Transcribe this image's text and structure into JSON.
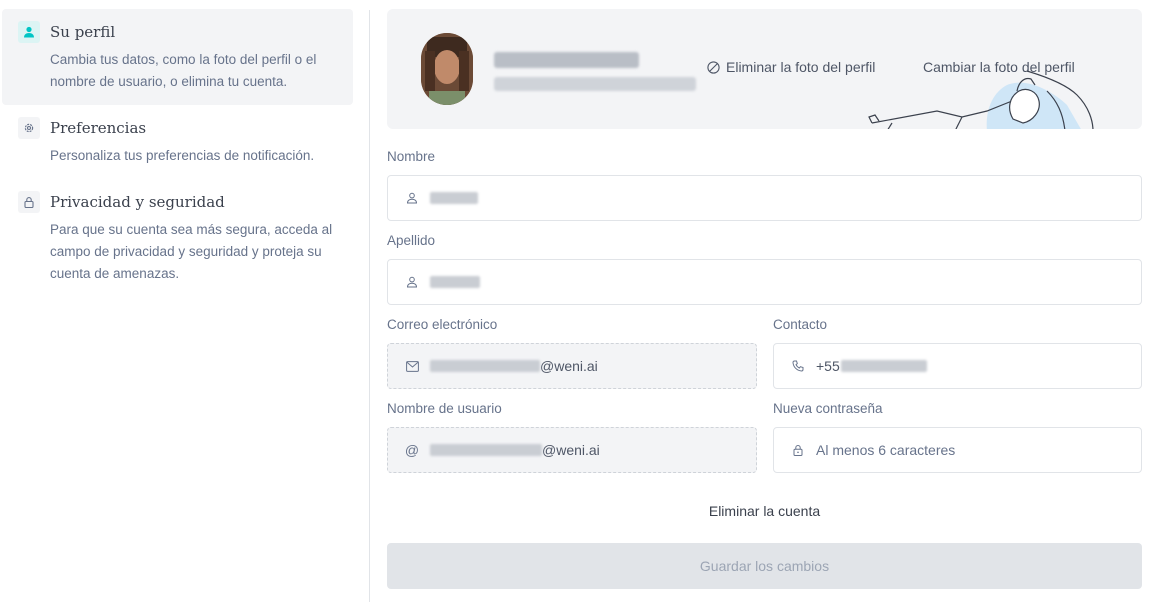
{
  "menu": {
    "items": [
      {
        "title": "Su perfil",
        "desc": "Cambia tus datos, como la foto del perfil o el nombre de usuario, o elimina tu cuenta.",
        "icon": "user-icon",
        "active": true
      },
      {
        "title": "Preferencias",
        "desc": "Personaliza tus preferencias de notificación.",
        "icon": "gear-icon",
        "active": false
      },
      {
        "title": "Privacidad y seguridad",
        "desc": "Para que su cuenta sea más segura, acceda al campo de privacidad y seguridad y proteja su cuenta de amenazas.",
        "icon": "lock-icon",
        "active": false
      }
    ]
  },
  "banner": {
    "remove_photo": "Eliminar la foto del perfil",
    "change_photo": "Cambiar la foto del perfil"
  },
  "form": {
    "name_label": "Nombre",
    "lastname_label": "Apellido",
    "email_label": "Correo electrónico",
    "email_suffix": "@weni.ai",
    "contact_label": "Contacto",
    "contact_prefix": "+55",
    "username_label": "Nombre de usuario",
    "username_suffix": "@weni.ai",
    "password_label": "Nueva contraseña",
    "password_placeholder": "Al menos 6 caracteres"
  },
  "actions": {
    "delete_account": "Eliminar la cuenta",
    "save": "Guardar los cambios"
  },
  "colors": {
    "accent": "#00c5c5",
    "active_bg": "#f3f4f6",
    "border": "#e1e4e8",
    "text": "#4e5666"
  }
}
